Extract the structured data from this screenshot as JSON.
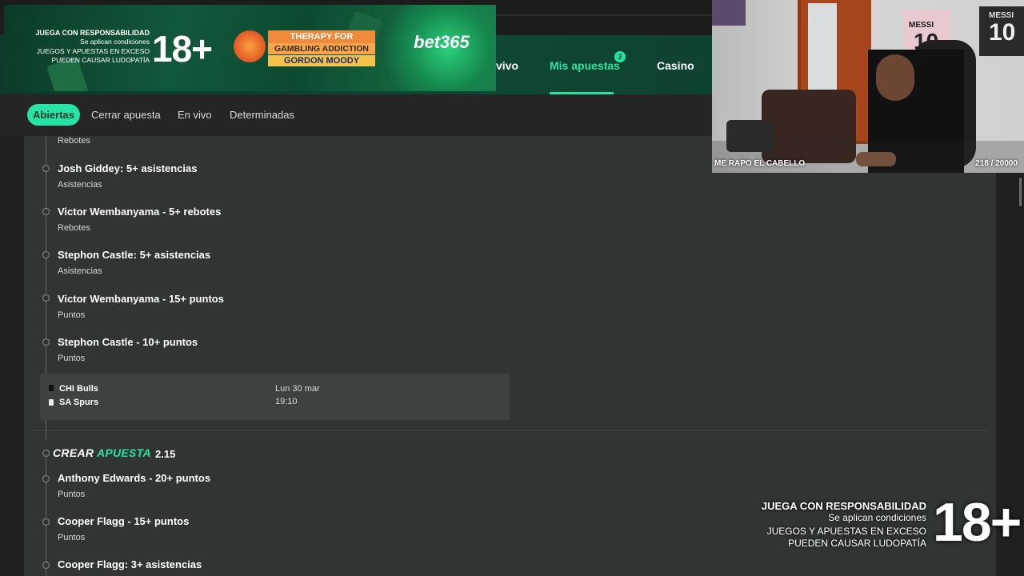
{
  "nav": {
    "items": [
      {
        "label": "vivo"
      },
      {
        "label": "Mis apuestas",
        "badge": "2"
      },
      {
        "label": "Casino"
      }
    ]
  },
  "subtabs": [
    "Abiertas",
    "Cerrar apuesta",
    "En vivo",
    "Determinadas"
  ],
  "bet1": {
    "top_market": "Rebotes",
    "legs": [
      {
        "name": "Josh Giddey: 5+ asistencias",
        "market": "Asistencias"
      },
      {
        "name": "Victor Wembanyama - 5+ rebotes",
        "market": "Rebotes"
      },
      {
        "name": "Stephon Castle: 5+ asistencias",
        "market": "Asistencias"
      },
      {
        "name": "Victor Wembanyama - 15+ puntos",
        "market": "Puntos"
      },
      {
        "name": "Stephon Castle - 10+ puntos",
        "market": "Puntos"
      }
    ],
    "match": {
      "team1": "CHI Bulls",
      "team2": "SA Spurs",
      "date": "Lun 30 mar",
      "time": "19:10"
    }
  },
  "bet2": {
    "title_part1": "CREAR",
    "title_part2": "APUESTA",
    "odds": "2.15",
    "legs": [
      {
        "name": "Anthony Edwards - 20+ puntos",
        "market": "Puntos"
      },
      {
        "name": "Cooper Flagg - 15+ puntos",
        "market": "Puntos"
      },
      {
        "name": "Cooper Flagg: 3+ asistencias",
        "market": ""
      }
    ]
  },
  "ad": {
    "line1": "JUEGA CON RESPONSABILIDAD",
    "line2": "Se aplican condiciones",
    "line3": "JUEGOS Y APUESTAS EN EXCESO",
    "line4": "PUEDEN CAUSAR LUDOPATÍA",
    "age": "18+",
    "therapy": "THERAPY FOR",
    "gambling": "GAMBLING ADDICTION",
    "gordon": "GORDON MOODY",
    "brand": "bet365"
  },
  "webcam": {
    "caption": "ME RAPO EL CABELLO",
    "counter": "218 / 20000",
    "poster1_name": "MESSI",
    "poster1_number": "10",
    "poster2_name": "MESSI",
    "poster2_number": "10"
  },
  "overlay": {
    "line1": "JUEGA CON RESPONSABILIDAD",
    "line2": "Se aplican condiciones",
    "line3": "JUEGOS Y APUESTAS EN EXCESO",
    "line4": "PUEDEN CAUSAR LUDOPATÍA",
    "age": "18+"
  },
  "colors": {
    "accent": "#27e3a5",
    "nav_bg": "#0f4634",
    "card_bg": "#303532",
    "page_bg": "#1f201f"
  }
}
